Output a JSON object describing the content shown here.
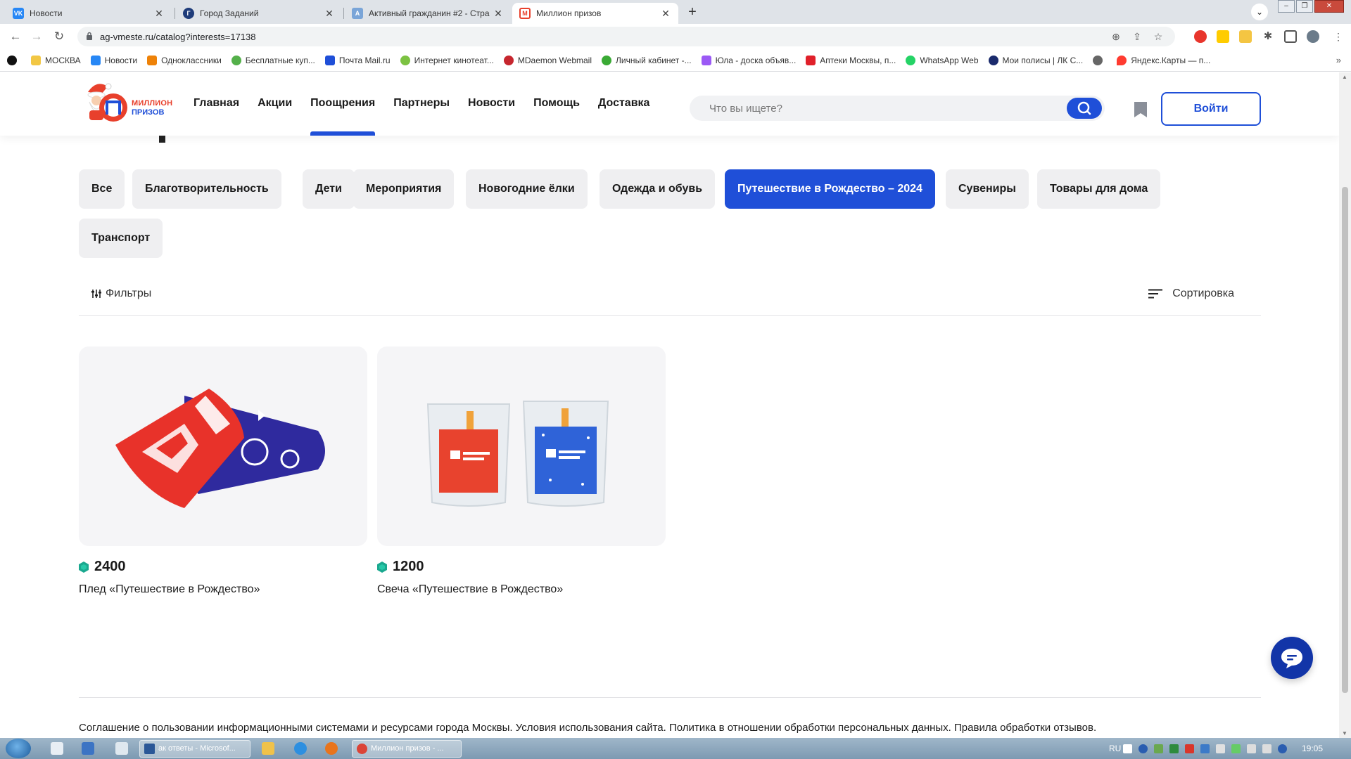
{
  "browser": {
    "tabs": [
      {
        "title": "Новости",
        "icon": "vk-icon",
        "color": "#2787f5",
        "glyph": "VK"
      },
      {
        "title": "Город Заданий",
        "icon": "city-tasks-icon",
        "color": "#1f3c7a",
        "glyph": "Г"
      },
      {
        "title": "Активный гражданин #2 - Стра",
        "icon": "ag-icon",
        "color": "#7aa5d8",
        "glyph": "А"
      },
      {
        "title": "Миллион призов",
        "icon": "million-prizes-icon",
        "color": "#e8402c",
        "glyph": "М"
      }
    ],
    "url": "ag-vmeste.ru/catalog?interests=17138",
    "bookmarks": [
      {
        "label": "МОСКВА",
        "color": "#f2c744"
      },
      {
        "label": "Новости",
        "color": "#2787f5"
      },
      {
        "label": "Одноклассники",
        "color": "#ee8208"
      },
      {
        "label": "Бесплатные куп...",
        "color": "#54b04a"
      },
      {
        "label": "Почта Mail.ru",
        "color": "#1f4fd8"
      },
      {
        "label": "Интернет кинотеат...",
        "color": "#7cc242"
      },
      {
        "label": "MDaemon Webmail",
        "color": "#c6262e"
      },
      {
        "label": "Личный кабинет -...",
        "color": "#3aaa35"
      },
      {
        "label": "Юла - доска объяв...",
        "color": "#9b59f5"
      },
      {
        "label": "Аптеки Москвы, п...",
        "color": "#e0202a"
      },
      {
        "label": "WhatsApp Web",
        "color": "#25d366"
      },
      {
        "label": "Мои полисы | ЛК С...",
        "color": "#1a2a6c"
      },
      {
        "label": "",
        "color": "#666666"
      },
      {
        "label": "Яндекс.Карты — п...",
        "color": "#ff3b30"
      }
    ]
  },
  "site": {
    "logo": {
      "line1": "МИЛЛИОН",
      "line2": "ПРИЗОВ"
    },
    "nav": [
      "Главная",
      "Акции",
      "Поощрения",
      "Партнеры",
      "Новости",
      "Помощь",
      "Доставка"
    ],
    "active_nav": "Поощрения",
    "search_placeholder": "Что вы ищете?",
    "login_label": "Войти",
    "categories": [
      {
        "label": "Все",
        "active": false
      },
      {
        "label": "Благотворительность",
        "active": false
      },
      {
        "label": "Дети",
        "active": false
      },
      {
        "label": "Мероприятия",
        "active": false
      },
      {
        "label": "Новогодние ёлки",
        "active": false
      },
      {
        "label": "Одежда и обувь",
        "active": false
      },
      {
        "label": "Путешествие в Рождество – 2024",
        "active": true
      },
      {
        "label": "Сувениры",
        "active": false
      },
      {
        "label": "Товары для дома",
        "active": false
      },
      {
        "label": "Транспорт",
        "active": false
      }
    ],
    "filters_label": "Фильтры",
    "sort_label": "Сортировка",
    "products": [
      {
        "price": "2400",
        "name": "Плед «Путешествие в Рождество»"
      },
      {
        "price": "1200",
        "name": "Свеча «Путешествие в Рождество»"
      }
    ],
    "footer": "Соглашение о пользовании информационными системами и ресурсами города Москвы. Условия использования сайта. Политика в отношении обработки персональных данных. Правила обработки отзывов.",
    "accent": "#1f4fd8",
    "brand_red": "#e8402c"
  },
  "taskbar": {
    "tasks": [
      "ак ответы - Microsof...",
      "Миллион призов - ..."
    ],
    "lang": "RU",
    "time": "19:05"
  }
}
